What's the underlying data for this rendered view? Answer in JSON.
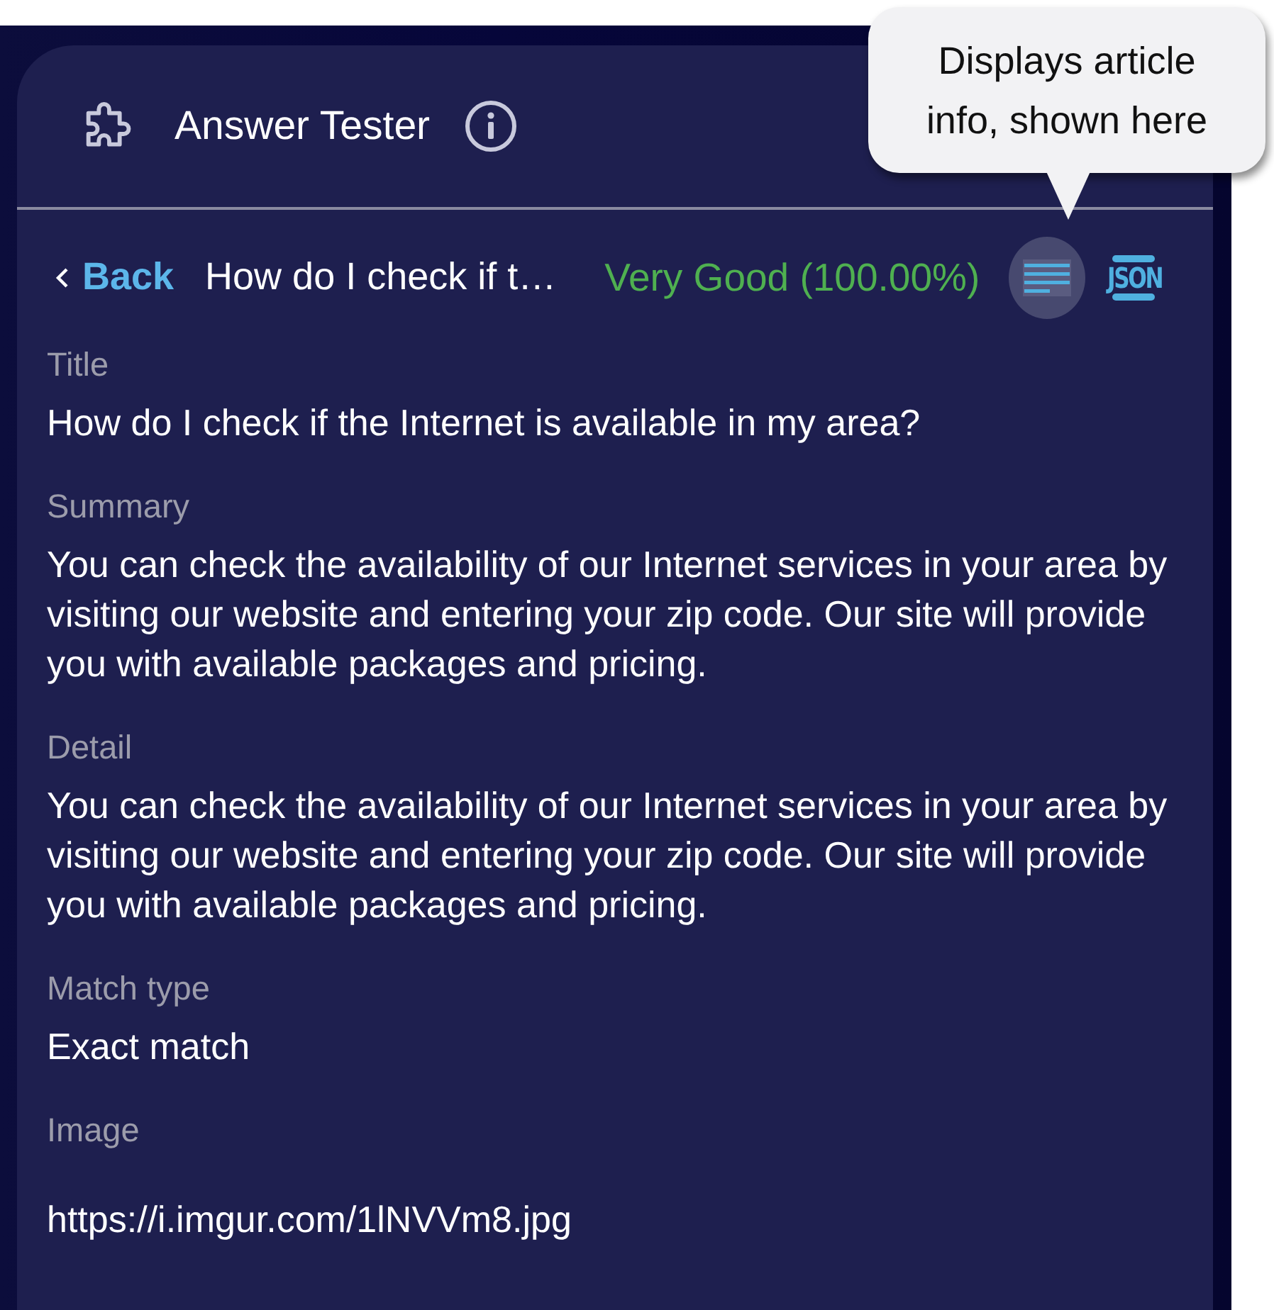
{
  "header": {
    "title": "Answer Tester"
  },
  "tooltip": {
    "text": "Displays article info, shown here"
  },
  "nav": {
    "back": "Back",
    "article_title": "How do I check if t…",
    "rating": "Very Good (100.00%)",
    "views": [
      {
        "kind": "article",
        "selected": true
      },
      {
        "kind": "json",
        "label": "JSON",
        "selected": false
      }
    ]
  },
  "fields": [
    {
      "kind": "text",
      "label": "Title",
      "value": "How do I check if the Internet is available in my area?"
    },
    {
      "kind": "text",
      "label": "Summary",
      "value": "You can check the availability of our Internet services in your area by visiting our website and entering your zip code. Our site will provide you with available packages and pricing."
    },
    {
      "kind": "text",
      "label": "Detail",
      "value": "You can check the availability of our Internet services in your area by visiting our website and entering your zip code. Our site will provide you with available packages and pricing."
    },
    {
      "kind": "text",
      "label": "Match type",
      "value": "Exact match"
    },
    {
      "kind": "image",
      "label": "Image",
      "value": "https://i.imgur.com/1lNVVm8.jpg"
    }
  ]
}
